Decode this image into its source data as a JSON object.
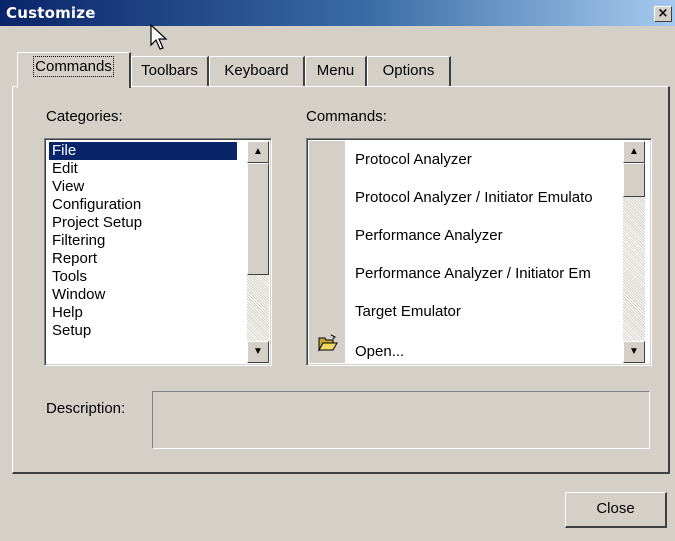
{
  "window": {
    "title": "Customize",
    "close_glyph": "×"
  },
  "tabs": [
    {
      "label": "Commands",
      "active": true
    },
    {
      "label": "Toolbars"
    },
    {
      "label": "Keyboard"
    },
    {
      "label": "Menu"
    },
    {
      "label": "Options"
    }
  ],
  "categories": {
    "label": "Categories:",
    "items": [
      "File",
      "Edit",
      "View",
      "Configuration",
      "Project Setup",
      "Filtering",
      "Report",
      "Tools",
      "Window",
      "Help",
      "Setup"
    ],
    "selected": "File"
  },
  "commands": {
    "label": "Commands:",
    "items": [
      {
        "label": "Protocol Analyzer",
        "icon": ""
      },
      {
        "label": "Protocol Analyzer / Initiator Emulato",
        "icon": ""
      },
      {
        "label": "Performance Analyzer",
        "icon": ""
      },
      {
        "label": "Performance Analyzer / Initiator Em",
        "icon": ""
      },
      {
        "label": "Target Emulator",
        "icon": ""
      },
      {
        "label": "Open...",
        "icon": "open-folder-icon"
      }
    ]
  },
  "description": {
    "label": "Description:",
    "value": ""
  },
  "buttons": {
    "close": "Close"
  },
  "colors": {
    "selection": "#0a246a",
    "face": "#d4d0c8",
    "title_start": "#0a246a",
    "title_end": "#a6caf0"
  }
}
